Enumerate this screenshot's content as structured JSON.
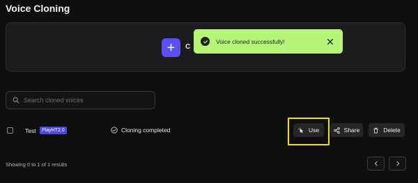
{
  "page": {
    "title": "Voice Cloning"
  },
  "create": {
    "icon": "plus-icon",
    "label_partial": "C"
  },
  "toast": {
    "message": "Voice cloned successfully!",
    "icon": "check-circle-icon",
    "close_icon": "close-icon",
    "color": "#b7f57a"
  },
  "search": {
    "placeholder": "Search cloned voices",
    "value": "",
    "icon": "search-icon"
  },
  "voices": [
    {
      "name": "Test",
      "badge": "PlayHT2.0",
      "status": "Cloning completed",
      "status_icon": "check-circle-icon",
      "actions": {
        "use": "Use",
        "share": "Share",
        "delete": "Delete"
      }
    }
  ],
  "footer": {
    "results_text": "Showing 0 to 1 of 1 results"
  },
  "colors": {
    "accent": "#5b4ff2",
    "badge": "#4f46e5",
    "highlight": "#f5e400"
  }
}
